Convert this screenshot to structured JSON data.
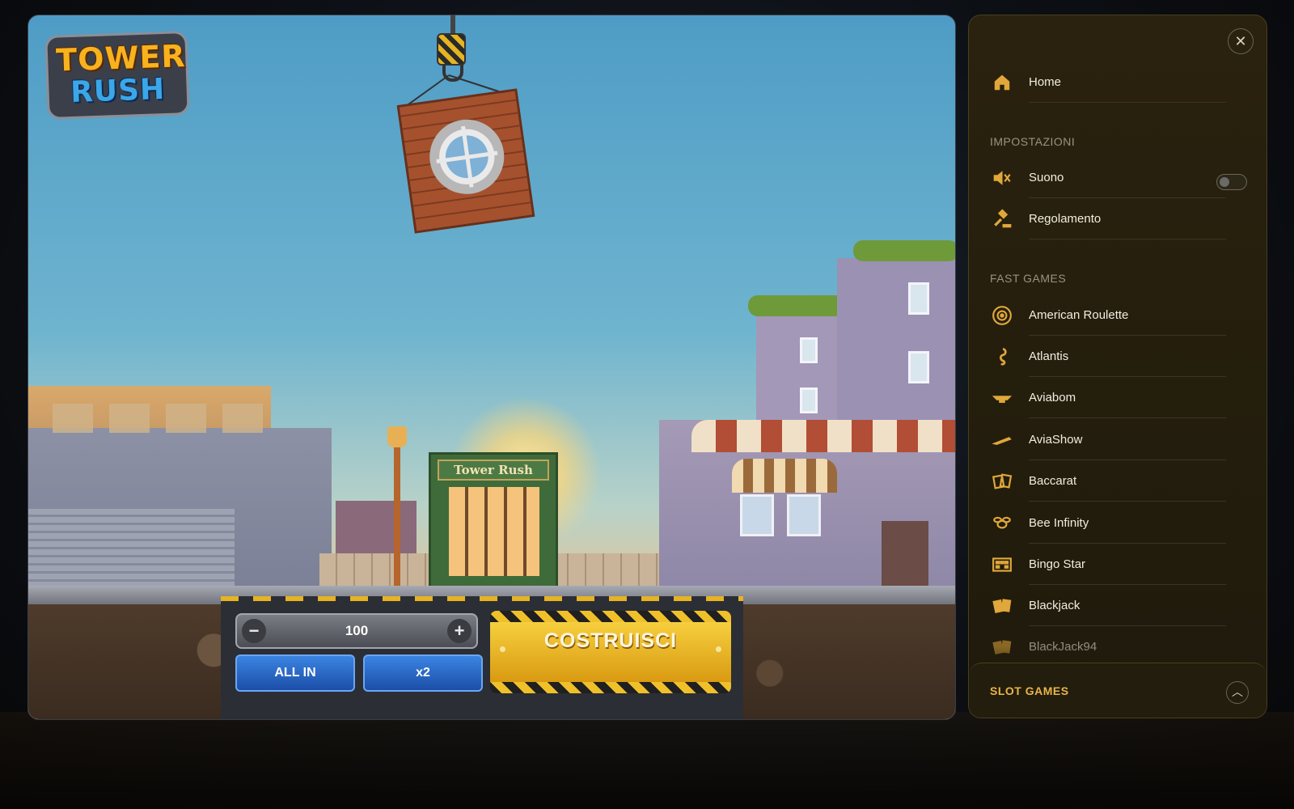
{
  "game": {
    "logo_top": "TOWER",
    "logo_bottom": "RUSH",
    "shop_sign": "Tower Rush",
    "bet": {
      "minus_symbol": "−",
      "value": "100",
      "plus_symbol": "+"
    },
    "buttons": {
      "all_in": "ALL IN",
      "double": "x2",
      "build": "COSTRUISCI"
    }
  },
  "sidebar": {
    "close_symbol": "✕",
    "home": {
      "label": "Home",
      "icon": "home-icon"
    },
    "settings_title": "IMPOSTAZIONI",
    "settings": [
      {
        "label": "Suono",
        "icon": "sound-muted-icon",
        "toggle_on": false
      },
      {
        "label": "Regolamento",
        "icon": "gavel-icon"
      }
    ],
    "fast_games_title": "FAST GAMES",
    "fast_games": [
      {
        "label": "American Roulette",
        "icon": "roulette-icon"
      },
      {
        "label": "Atlantis",
        "icon": "seahorse-icon"
      },
      {
        "label": "Aviabom",
        "icon": "plane-icon"
      },
      {
        "label": "AviaShow",
        "icon": "jet-icon"
      },
      {
        "label": "Baccarat",
        "icon": "cards-icon"
      },
      {
        "label": "Bee Infinity",
        "icon": "bee-icon"
      },
      {
        "label": "Bingo Star",
        "icon": "bingo-icon"
      },
      {
        "label": "Blackjack",
        "icon": "blackjack-cards-icon"
      },
      {
        "label": "BlackJack94",
        "icon": "blackjack-cards-icon"
      }
    ],
    "slot_games_title": "SLOT GAMES",
    "slot_toggle_symbol": "︿"
  },
  "colors": {
    "accent_gold": "#e0a73a",
    "sidebar_bg": "#2a220e",
    "button_blue": "#2a6ad0",
    "build_yellow": "#f0c02a"
  }
}
